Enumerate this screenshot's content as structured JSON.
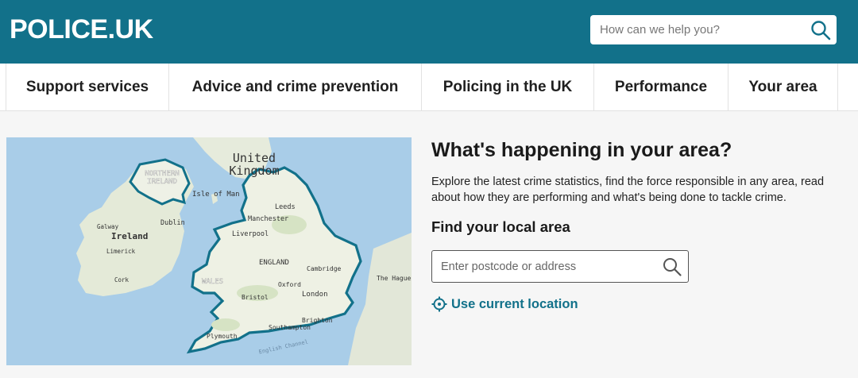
{
  "header": {
    "logo": "POLICE.UK",
    "search_placeholder": "How can we help you?"
  },
  "nav": {
    "items": [
      {
        "label": "Support services"
      },
      {
        "label": "Advice and crime prevention"
      },
      {
        "label": "Policing in the UK"
      },
      {
        "label": "Performance"
      },
      {
        "label": "Your area"
      }
    ]
  },
  "map": {
    "labels": {
      "united_kingdom_1": "United",
      "united_kingdom_2": "Kingdom",
      "northern_1": "NORTHERN",
      "northern_2": "IRELAND",
      "isle_of_man": "Isle of Man",
      "leeds": "Leeds",
      "manchester": "Manchester",
      "liverpool": "Liverpool",
      "ireland": "Ireland",
      "dublin": "Dublin",
      "galway": "Galway",
      "limerick": "Limerick",
      "cork": "Cork",
      "england": "ENGLAND",
      "cambridge": "Cambridge",
      "wales": "WALES",
      "oxford": "Oxford",
      "london": "London",
      "bristol": "Bristol",
      "southampton": "Southampton",
      "brighton": "Brighton",
      "plymouth": "Plymouth",
      "english_channel": "English Channel",
      "the_hague": "The Hague"
    }
  },
  "panel": {
    "title": "What's happening in your area?",
    "intro": "Explore the latest crime statistics, find the force responsible in any area, read about how they are performing and what's being done to tackle crime.",
    "find_heading": "Find your local area",
    "area_placeholder": "Enter postcode or address",
    "locate_label": "Use current location"
  },
  "colors": {
    "brand": "#12718a",
    "sea": "#a9cde8",
    "land": "#e8ecde"
  }
}
